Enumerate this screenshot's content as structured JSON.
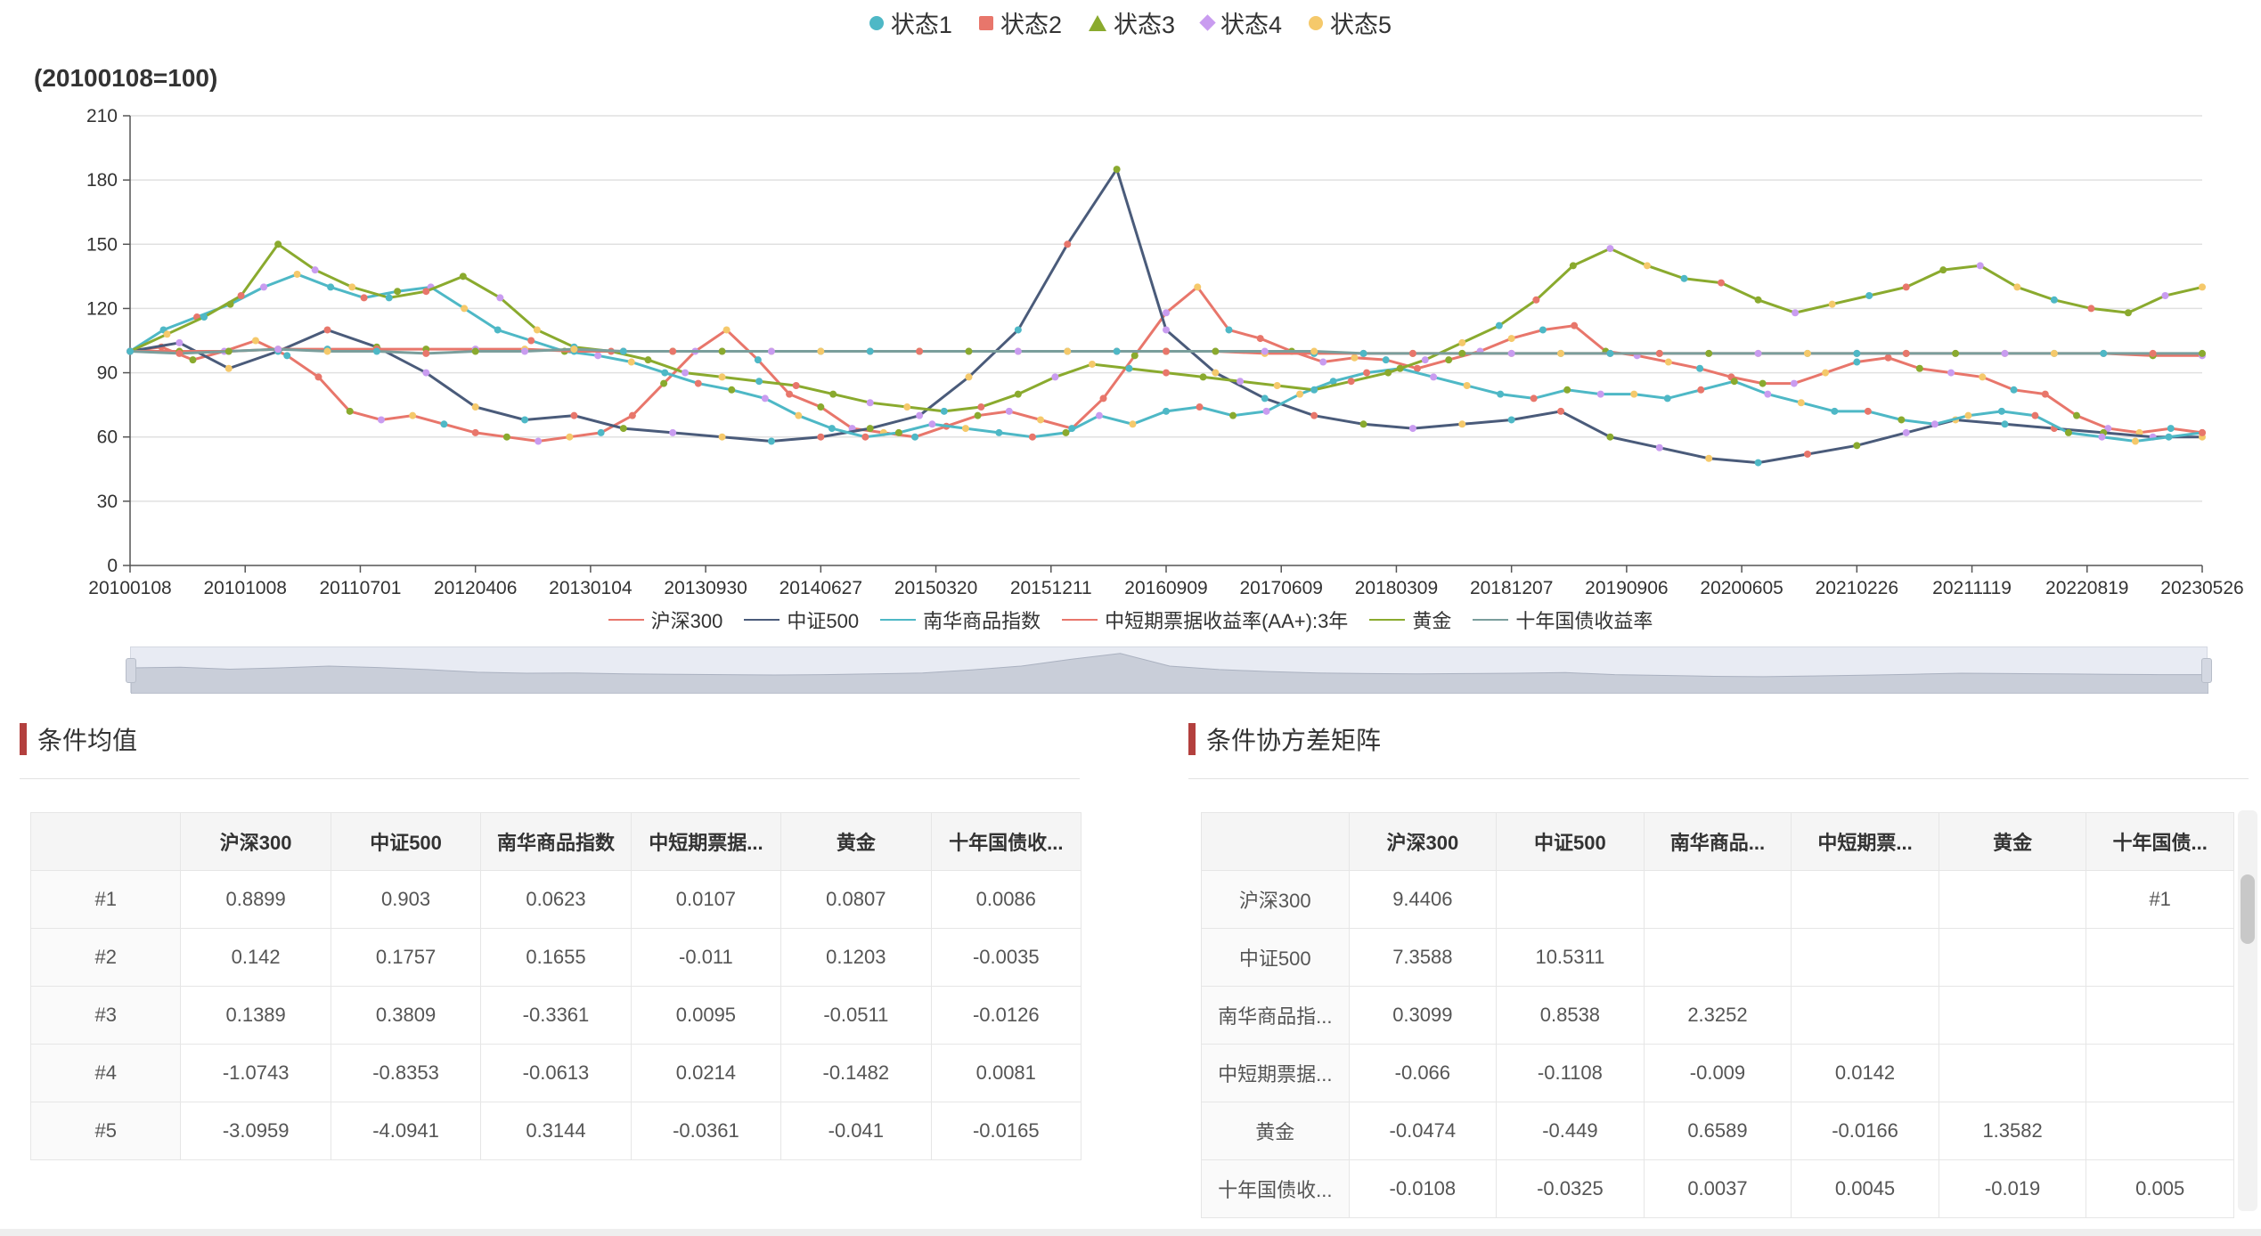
{
  "state_legend": [
    {
      "label": "状态1",
      "color": "#4eb8c6",
      "shape": "circle"
    },
    {
      "label": "状态2",
      "color": "#e8766b",
      "shape": "rect"
    },
    {
      "label": "状态3",
      "color": "#8aaa2e",
      "shape": "triangle"
    },
    {
      "label": "状态4",
      "color": "#c99cf0",
      "shape": "diamond"
    },
    {
      "label": "状态5",
      "color": "#f5c96b",
      "shape": "circle"
    }
  ],
  "chart_data": {
    "type": "line",
    "title": "(20100108=100)",
    "ylim": [
      0,
      210
    ],
    "yticks": [
      "0",
      "30",
      "60",
      "90",
      "120",
      "150",
      "180",
      "210"
    ],
    "xticks": [
      "20100108",
      "20101008",
      "20110701",
      "20120406",
      "20130104",
      "20130930",
      "20140627",
      "20150320",
      "20151211",
      "20160909",
      "20170609",
      "20180309",
      "20181207",
      "20190906",
      "20200605",
      "20210226",
      "20211119",
      "20220819",
      "20230526"
    ],
    "grid": true,
    "series": [
      {
        "name": "沪深300",
        "color": "#e8766b",
        "values": [
          100,
          102,
          96,
          100,
          105,
          98,
          88,
          72,
          68,
          70,
          66,
          62,
          60,
          58,
          60,
          62,
          70,
          85,
          100,
          110,
          96,
          80,
          74,
          64,
          62,
          60,
          65,
          70,
          72,
          68,
          64,
          78,
          98,
          118,
          130,
          110,
          106,
          100,
          95,
          97,
          96,
          92,
          96,
          100,
          106,
          110,
          112,
          100,
          98,
          95,
          92,
          88,
          85,
          85,
          90,
          95,
          97,
          92,
          90,
          88,
          82,
          80,
          70,
          64,
          62,
          64,
          62
        ]
      },
      {
        "name": "中证500",
        "color": "#4a5b7a",
        "values": [
          100,
          104,
          92,
          100,
          110,
          102,
          90,
          74,
          68,
          70,
          64,
          62,
          60,
          58,
          60,
          64,
          70,
          88,
          110,
          150,
          185,
          110,
          90,
          78,
          70,
          66,
          64,
          66,
          68,
          72,
          60,
          55,
          50,
          48,
          52,
          56,
          62,
          68,
          66,
          64,
          62,
          60,
          60
        ]
      },
      {
        "name": "南华商品指数",
        "color": "#4eb8c6",
        "values": [
          100,
          110,
          116,
          122,
          130,
          136,
          130,
          125,
          128,
          130,
          120,
          110,
          105,
          100,
          98,
          95,
          90,
          85,
          82,
          78,
          70,
          64,
          60,
          62,
          66,
          64,
          62,
          60,
          62,
          70,
          66,
          72,
          74,
          70,
          72,
          80,
          86,
          90,
          92,
          88,
          84,
          80,
          78,
          82,
          80,
          80,
          78,
          82,
          86,
          80,
          76,
          72,
          72,
          68,
          66,
          70,
          72,
          70,
          62,
          60,
          58,
          60,
          62
        ]
      },
      {
        "name": "中短期票据收益率(AA+):3年",
        "color": "#e8766b",
        "values": [
          100,
          100,
          100,
          101,
          101,
          101,
          101,
          101,
          101,
          100,
          100,
          100,
          100,
          100,
          100,
          100,
          100,
          100,
          100,
          100,
          100,
          100,
          100,
          99,
          99,
          99,
          99,
          99,
          99,
          99,
          99,
          99,
          99,
          99,
          99,
          99,
          99,
          99,
          99,
          99,
          99,
          98,
          98
        ]
      },
      {
        "name": "黄金",
        "color": "#8aaa2e",
        "values": [
          100,
          108,
          116,
          126,
          150,
          138,
          130,
          125,
          128,
          135,
          125,
          110,
          102,
          100,
          96,
          90,
          88,
          86,
          84,
          80,
          76,
          74,
          72,
          74,
          80,
          88,
          94,
          92,
          90,
          88,
          86,
          84,
          82,
          86,
          90,
          96,
          104,
          112,
          124,
          140,
          148,
          140,
          134,
          132,
          124,
          118,
          122,
          126,
          130,
          138,
          140,
          130,
          124,
          120,
          118,
          126,
          130
        ]
      },
      {
        "name": "十年国债收益率",
        "color": "#7a9e9c",
        "values": [
          100,
          99,
          100,
          101,
          100,
          100,
          99,
          100,
          100,
          101,
          100,
          100,
          100,
          100,
          100,
          100,
          100,
          100,
          100,
          100,
          100,
          100,
          100,
          100,
          100,
          99,
          99,
          99,
          99,
          99,
          99,
          99,
          99,
          99,
          99,
          99,
          99,
          99,
          99,
          99,
          99,
          99,
          99
        ]
      }
    ]
  },
  "series_legend": [
    {
      "label": "沪深300",
      "color": "#e8766b"
    },
    {
      "label": "中证500",
      "color": "#4a5b7a"
    },
    {
      "label": "南华商品指数",
      "color": "#4eb8c6"
    },
    {
      "label": "中短期票据收益率(AA+):3年",
      "color": "#e8766b"
    },
    {
      "label": "黄金",
      "color": "#8aaa2e"
    },
    {
      "label": "十年国债收益率",
      "color": "#7a9e9c"
    }
  ],
  "mean_panel": {
    "title": "条件均值",
    "headers": [
      "",
      "沪深300",
      "中证500",
      "南华商品指数",
      "中短期票据...",
      "黄金",
      "十年国债收..."
    ],
    "rows": [
      [
        "#1",
        "0.8899",
        "0.903",
        "0.0623",
        "0.0107",
        "0.0807",
        "0.0086"
      ],
      [
        "#2",
        "0.142",
        "0.1757",
        "0.1655",
        "-0.011",
        "0.1203",
        "-0.0035"
      ],
      [
        "#3",
        "0.1389",
        "0.3809",
        "-0.3361",
        "0.0095",
        "-0.0511",
        "-0.0126"
      ],
      [
        "#4",
        "-1.0743",
        "-0.8353",
        "-0.0613",
        "0.0214",
        "-0.1482",
        "0.0081"
      ],
      [
        "#5",
        "-3.0959",
        "-4.0941",
        "0.3144",
        "-0.0361",
        "-0.041",
        "-0.0165"
      ]
    ]
  },
  "cov_panel": {
    "title": "条件协方差矩阵",
    "headers": [
      "",
      "沪深300",
      "中证500",
      "南华商品...",
      "中短期票...",
      "黄金",
      "十年国债..."
    ],
    "rows": [
      [
        "沪深300",
        "9.4406",
        "",
        "",
        "",
        "",
        "#1"
      ],
      [
        "中证500",
        "7.3588",
        "10.5311",
        "",
        "",
        "",
        ""
      ],
      [
        "南华商品指...",
        "0.3099",
        "0.8538",
        "2.3252",
        "",
        "",
        ""
      ],
      [
        "中短期票据...",
        "-0.066",
        "-0.1108",
        "-0.009",
        "0.0142",
        "",
        ""
      ],
      [
        "黄金",
        "-0.0474",
        "-0.449",
        "0.6589",
        "-0.0166",
        "1.3582",
        ""
      ],
      [
        "十年国债收...",
        "-0.0108",
        "-0.0325",
        "0.0037",
        "0.0045",
        "-0.019",
        "0.005"
      ]
    ]
  }
}
